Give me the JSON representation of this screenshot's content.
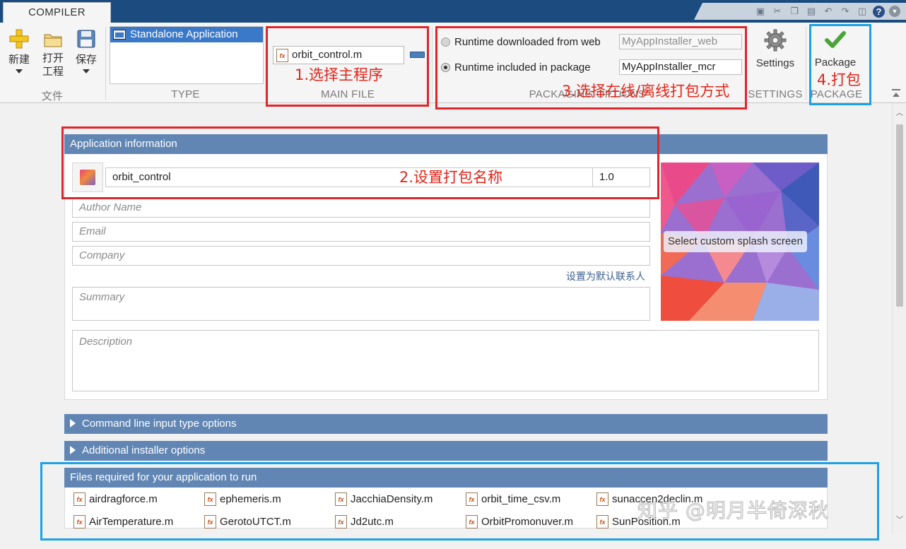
{
  "tab": "COMPILER",
  "ribbon": {
    "file_group": {
      "label": "文件",
      "new": "新建",
      "open_line1": "打开",
      "open_line2": "工程",
      "save": "保存"
    },
    "type_group": {
      "label": "TYPE",
      "selected": "Standalone Application"
    },
    "main_file_group": {
      "label": "MAIN FILE",
      "file": "orbit_control.m"
    },
    "packaging_group": {
      "label": "PACKAGING OPTIONS",
      "option_web": "Runtime downloaded from web",
      "option_web_value": "MyAppInstaller_web",
      "option_pkg": "Runtime included in package",
      "option_pkg_value": "MyAppInstaller_mcr"
    },
    "settings_group": {
      "label": "SETTINGS",
      "button": "Settings"
    },
    "package_group": {
      "label": "PACKAGE",
      "button": "Package"
    }
  },
  "annotations": {
    "step1": "1.选择主程序",
    "step2": "2.设置打包名称",
    "step3": "3.选择在线/离线打包方式",
    "step4": "4.打包"
  },
  "app_info": {
    "header": "Application information",
    "name": "orbit_control",
    "version": "1.0",
    "author_placeholder": "Author Name",
    "email_placeholder": "Email",
    "company_placeholder": "Company",
    "default_contact_link": "设置为默认联系人",
    "summary_placeholder": "Summary",
    "description_placeholder": "Description",
    "splash_button": "Select custom splash screen"
  },
  "sections": {
    "command_line": "Command line input type options",
    "installer": "Additional installer options",
    "files_required": "Files required for your application to run"
  },
  "files": [
    "airdragforce.m",
    "ephemeris.m",
    "JacchiaDensity.m",
    "orbit_time_csv.m",
    "sunaccen2declin.m",
    "AirTemperature.m",
    "GerotoUTCT.m",
    "Jd2utc.m",
    "OrbitPromonuver.m",
    "SunPosition.m"
  ],
  "watermark": "知乎 @明月半倚深秋",
  "colors": {
    "title_bar": "#1b4b7f",
    "panel_header": "#6186b4",
    "selection": "#3a78c8",
    "annotation_red": "#e0262a",
    "annotation_blue": "#1aa3e6"
  }
}
